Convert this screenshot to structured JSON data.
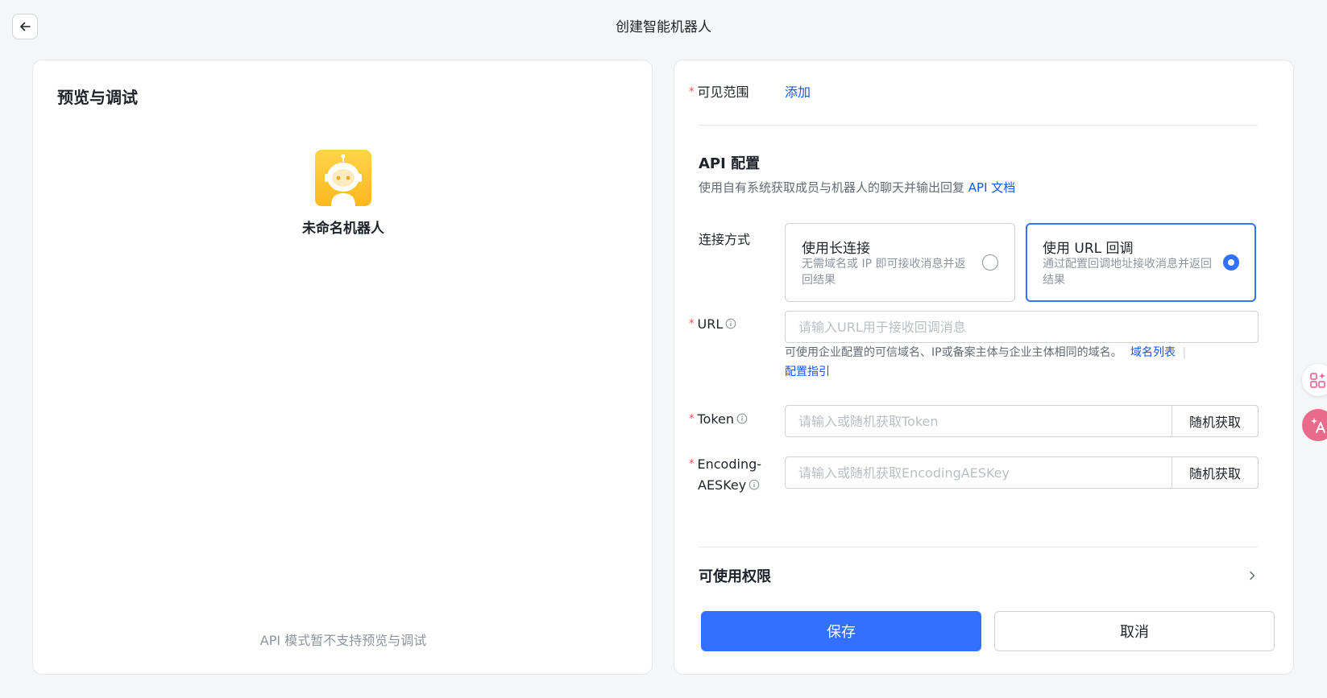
{
  "header": {
    "title": "创建智能机器人"
  },
  "preview": {
    "title": "预览与调试",
    "bot_name": "未命名机器人",
    "note": "API 模式暂不支持预览与调试"
  },
  "visibility": {
    "label": "可见范围",
    "add": "添加"
  },
  "api": {
    "title": "API 配置",
    "desc": "使用自有系统获取成员与机器人的聊天并输出回复",
    "doc_link": "API 文档",
    "connection_label": "连接方式",
    "options": [
      {
        "title": "使用长连接",
        "desc": "无需域名或 IP 即可接收消息并返回结果",
        "selected": false
      },
      {
        "title": "使用 URL 回调",
        "desc": "通过配置回调地址接收消息并返回结果",
        "selected": true
      }
    ],
    "url": {
      "label": "URL",
      "placeholder": "请输入URL用于接收回调消息",
      "hint": "可使用企业配置的可信域名、IP或备案主体与企业主体相同的域名。",
      "domain_list": "域名列表",
      "separator": "|",
      "config_guide": "配置指引"
    },
    "token": {
      "label": "Token",
      "placeholder": "请输入或随机获取Token",
      "button": "随机获取"
    },
    "aes": {
      "label_line1": "Encoding-",
      "label_line2": "AESKey",
      "placeholder": "请输入或随机获取EncodingAESKey",
      "button": "随机获取"
    }
  },
  "permissions": {
    "title": "可使用权限"
  },
  "footer": {
    "save": "保存",
    "cancel": "取消"
  },
  "colors": {
    "primary": "#3370ff",
    "required": "#f54a45",
    "link": "#1456f0"
  }
}
